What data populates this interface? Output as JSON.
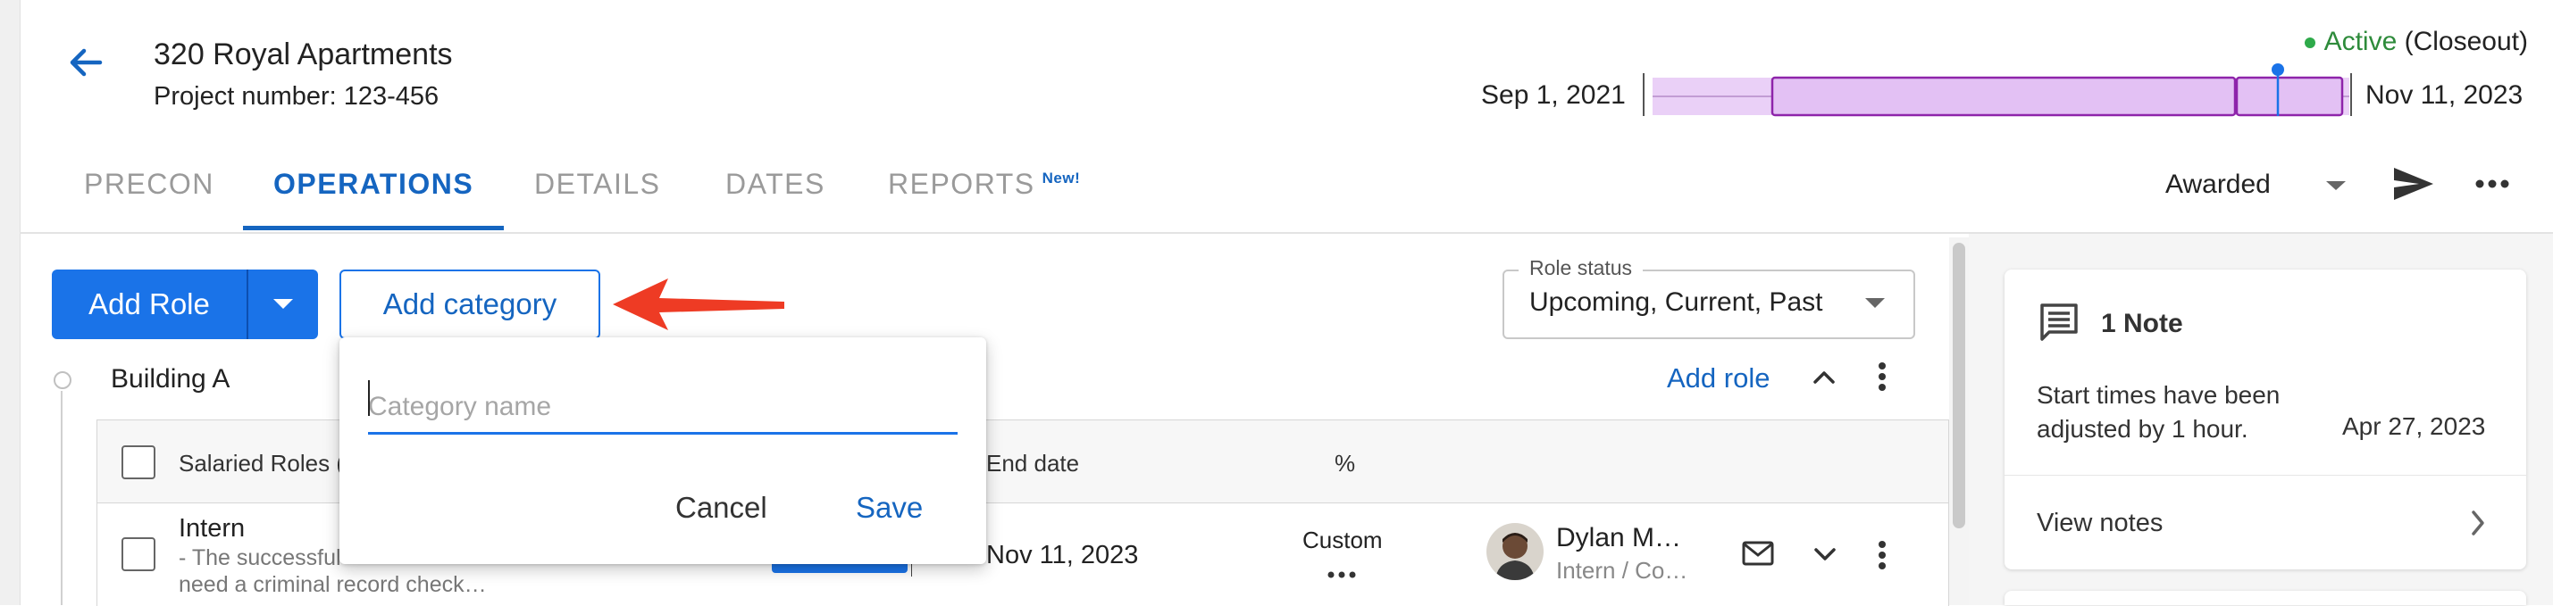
{
  "project": {
    "title": "320 Royal Apartments",
    "number": "Project number: 123-456"
  },
  "timeline": {
    "start": "Sep 1, 2021",
    "end": "Nov 11, 2023",
    "status_active": "Active",
    "status_phase": "(Closeout)",
    "colors": {
      "fill": "#e7c6f5",
      "border": "#8e24aa",
      "marker": "#1a73e8"
    }
  },
  "tabs": [
    {
      "label": "PRECON"
    },
    {
      "label": "OPERATIONS"
    },
    {
      "label": "DETAILS"
    },
    {
      "label": "DATES"
    },
    {
      "label": "REPORTS",
      "badge": "New!"
    }
  ],
  "toolbar": {
    "status_select": "Awarded",
    "add_role": "Add Role",
    "add_category": "Add category"
  },
  "role_status": {
    "legend": "Role status",
    "value": "Upcoming, Current, Past"
  },
  "building": {
    "name": "Building A",
    "add_role": "Add role"
  },
  "table": {
    "headers": {
      "roles": "Salaried Roles (",
      "end_date": "End date",
      "percent": "%"
    },
    "rows": [
      {
        "title": "Intern",
        "desc_line1": "- The successful",
        "desc_line2": "need a criminal record check…",
        "end_date": "Nov 11, 2023",
        "percent": "Custom",
        "person_name": "Dylan M…",
        "person_role": "Intern / Co…"
      }
    ]
  },
  "popover": {
    "placeholder": "Category name",
    "value": "",
    "cancel": "Cancel",
    "save": "Save"
  },
  "notes": {
    "title": "1 Note",
    "body_line1": "Start times have been",
    "body_line2": "adjusted by 1 hour.",
    "date": "Apr 27, 2023",
    "view": "View notes"
  },
  "colors": {
    "accent": "#1a73e8",
    "active_status": "#2e8b3b",
    "annotation_arrow": "#ee3b24"
  },
  "icons": {
    "back": "arrow-left-icon",
    "send": "send-icon",
    "more": "more-horizontal-icon",
    "note": "note-icon",
    "mail": "mail-icon"
  }
}
